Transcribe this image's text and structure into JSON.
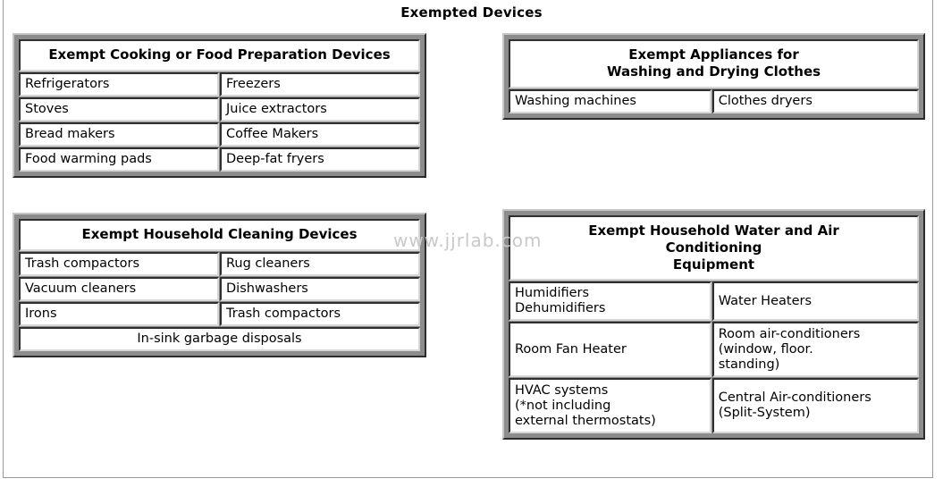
{
  "page": {
    "title": "Exempted Devices",
    "watermark": "www.jjrlab.com"
  },
  "tables": {
    "cooking": {
      "header": "Exempt Cooking or Food Preparation Devices",
      "rows": [
        [
          "Refrigerators",
          "Freezers"
        ],
        [
          "Stoves",
          "Juice extractors"
        ],
        [
          "Bread makers",
          "Coffee Makers"
        ],
        [
          "Food warming pads",
          "Deep-fat fryers"
        ]
      ]
    },
    "cleaning": {
      "header": "Exempt Household Cleaning Devices",
      "rows": [
        [
          "Trash compactors",
          "Rug cleaners"
        ],
        [
          "Vacuum cleaners",
          "Dishwashers"
        ],
        [
          "Irons",
          "Trash compactors"
        ]
      ],
      "full_row": "In-sink garbage disposals"
    },
    "washing": {
      "header": "Exempt Appliances for\nWashing and Drying Clothes",
      "header_line1": "Exempt Appliances for",
      "header_line2": "Washing and Drying Clothes",
      "rows": [
        [
          "Washing machines",
          "Clothes dryers"
        ]
      ]
    },
    "hvac": {
      "header_line1": "Exempt Household Water and Air",
      "header_line2": "Conditioning",
      "header_line3": "Equipment",
      "rows": [
        [
          "Humidifiers\nDehumidifiers",
          "Water Heaters"
        ],
        [
          "Room Fan Heater",
          "Room air-conditioners\n(window, floor.\nstanding)"
        ],
        [
          "HVAC systems\n(*not including\nexternal thermostats)",
          "Central Air-conditioners\n(Split-System)"
        ]
      ]
    }
  }
}
